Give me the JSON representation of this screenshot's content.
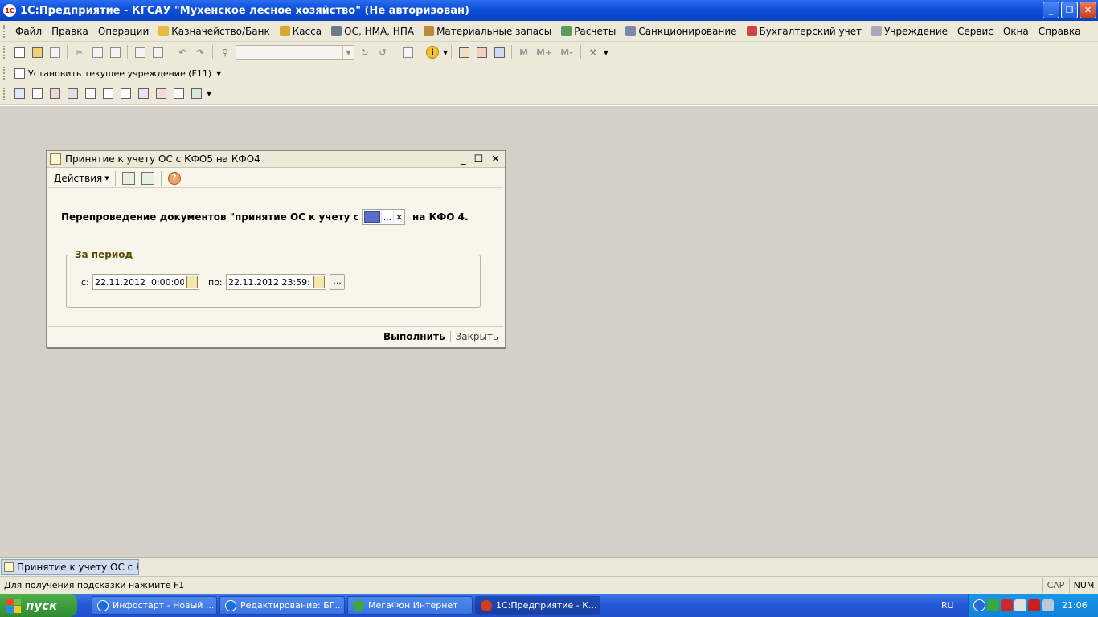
{
  "window": {
    "title": "1С:Предприятие - КГСАУ \"Мухенское лесное хозяйство\" (Не авторизован)",
    "logo_text": "1С"
  },
  "menu": {
    "items": [
      {
        "label": "Файл"
      },
      {
        "label": "Правка"
      },
      {
        "label": "Операции"
      },
      {
        "label": "Казначейство/Банк",
        "icon": "treasury-icon"
      },
      {
        "label": "Касса",
        "icon": "cash-icon"
      },
      {
        "label": "ОС, НМА, НПА",
        "icon": "assets-icon"
      },
      {
        "label": "Материальные запасы",
        "icon": "materials-icon"
      },
      {
        "label": "Расчеты",
        "icon": "settlements-icon"
      },
      {
        "label": "Санкционирование",
        "icon": "sigma-icon"
      },
      {
        "label": "Бухгалтерский учет",
        "icon": "accounting-icon"
      },
      {
        "label": "Учреждение",
        "icon": "institution-icon"
      },
      {
        "label": "Сервис"
      },
      {
        "label": "Окна"
      },
      {
        "label": "Справка"
      }
    ]
  },
  "toolbar2": {
    "set_institution_label": "Установить текущее учреждение (F11)"
  },
  "toolbar1": {
    "memory_labels": [
      "M",
      "M+",
      "M-"
    ],
    "info_glyph": "i"
  },
  "dialog": {
    "title": "Принятие к учету ОС с КФО5 на КФО4",
    "actions_label": "Действия",
    "help_glyph": "?",
    "repost_label": "Перепроведение документов \"принятие ОС к учету с КФО:",
    "kfo_suffix": "на КФО 4.",
    "kfo_dots": "...",
    "kfo_clear": "×",
    "period": {
      "legend": "За период",
      "from_label": "с:",
      "from_value": "22.11.2012  0:00:00",
      "to_label": "по:",
      "to_value": "22.11.2012 23:59:59",
      "dots": "..."
    },
    "execute_label": "Выполнить",
    "close_label": "Закрыть"
  },
  "windows_panel": {
    "tab_label": "Принятие к учету ОС с КФ..."
  },
  "status": {
    "hint": "Для получения подсказки нажмите F1",
    "cap": "CAP",
    "num": "NUM"
  },
  "taskbar": {
    "start_label": "пуск",
    "tasks": [
      {
        "label": "Инфостарт - Новый ...",
        "icon_color": "#1e6fd8"
      },
      {
        "label": "Редактирование: БГ...",
        "icon_color": "#1e6fd8"
      },
      {
        "label": "МегаФон Интернет",
        "icon_color": "#3aa83a"
      },
      {
        "label": "1С:Предприятие - К...",
        "icon_color": "#d83a1e"
      }
    ],
    "lang": "RU",
    "clock": "21:06"
  },
  "colors": {
    "titlebar": "#0a4fd8",
    "workspace": "#d4d0c8",
    "dialog_bg": "#f8f6ea",
    "kfo_value": "#5a6ec8"
  }
}
